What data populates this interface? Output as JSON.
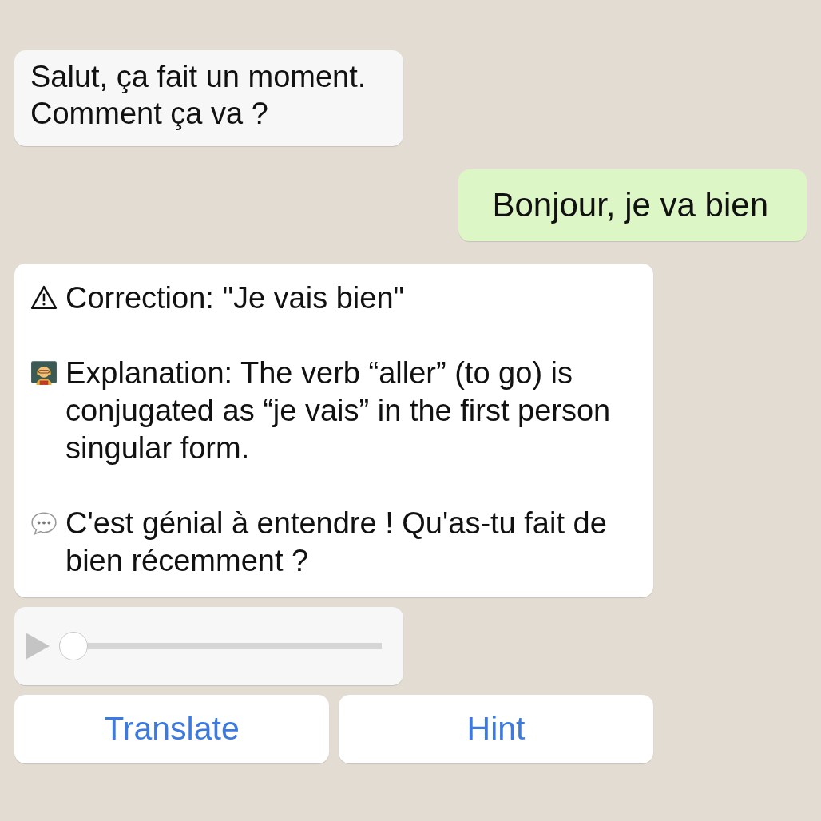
{
  "messages": [
    {
      "kind": "incoming",
      "text": "Salut, ça fait un moment.\nComment ça va ?"
    },
    {
      "kind": "outgoing",
      "text": "Bonjour, je va bien"
    },
    {
      "kind": "feedback",
      "paragraphs": [
        {
          "kind": "correction",
          "text": "Correction: \"Je vais bien\""
        },
        {
          "kind": "explanation",
          "text": "Explanation: The verb “aller” (to go) is conjugated as “je vais” in the first person singular form."
        },
        {
          "kind": "reply",
          "text": "C'est génial à entendre ! Qu'as-tu fait de bien récemment ?"
        }
      ]
    },
    {
      "kind": "audio",
      "level": 0
    }
  ],
  "buttons": [
    "Translate",
    "Hint"
  ]
}
